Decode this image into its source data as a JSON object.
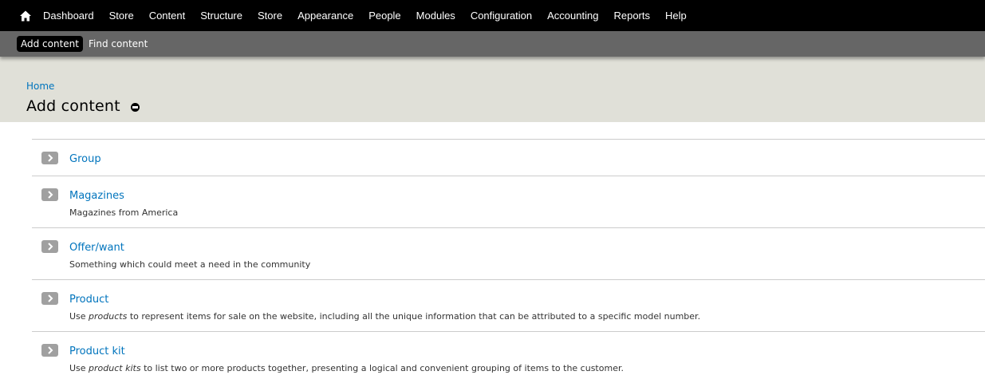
{
  "toolbar": {
    "home_icon": "home-icon",
    "items": [
      "Dashboard",
      "Store",
      "Content",
      "Structure",
      "Store",
      "Appearance",
      "People",
      "Modules",
      "Configuration",
      "Accounting",
      "Reports",
      "Help"
    ]
  },
  "shortcuts": {
    "items": [
      "Add content",
      "Find content"
    ]
  },
  "header": {
    "breadcrumb": "Home",
    "title": "Add content"
  },
  "content_types": [
    {
      "name": "Group",
      "desc_pre": "",
      "desc_em": "",
      "desc_post": ""
    },
    {
      "name": "Magazines",
      "desc_pre": "Magazines from America",
      "desc_em": "",
      "desc_post": ""
    },
    {
      "name": "Offer/want",
      "desc_pre": "Something which could meet a need in the community",
      "desc_em": "",
      "desc_post": ""
    },
    {
      "name": "Product",
      "desc_pre": "Use ",
      "desc_em": "products",
      "desc_post": " to represent items for sale on the website, including all the unique information that can be attributed to a specific model number."
    },
    {
      "name": "Product kit",
      "desc_pre": "Use ",
      "desc_em": "product kits",
      "desc_post": " to list two or more products together, presenting a logical and convenient grouping of items to the customer."
    }
  ],
  "colors": {
    "link": "#0074bd",
    "toolbar_bg": "#000000",
    "shortcut_bg": "#666666",
    "header_bg": "#e0e0d8"
  }
}
